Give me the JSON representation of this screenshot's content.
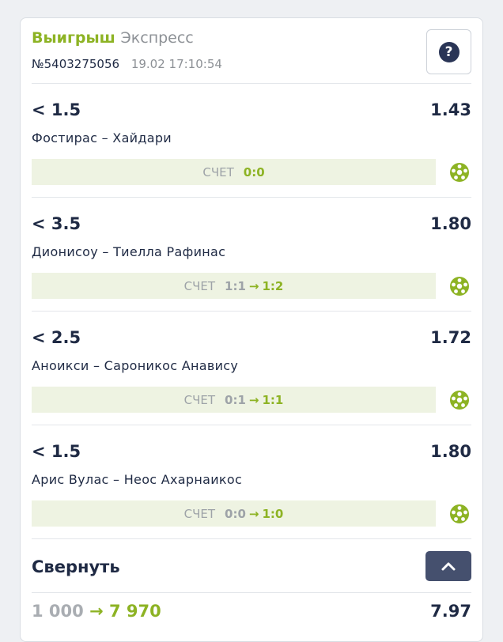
{
  "ticket": {
    "status": "Выигрыш",
    "type": "Экспресс",
    "number": "№5403275056",
    "datetime": "19.02 17:10:54",
    "help_icon": "question-icon",
    "help_label": "?"
  },
  "bets": [
    {
      "market": "< 1.5",
      "odds": "1.43",
      "match": "Фостирас – Хайдари",
      "score_label": "СЧЕТ",
      "score_start": "",
      "score_final": "0:0"
    },
    {
      "market": "< 3.5",
      "odds": "1.80",
      "match": "Дионисоу – Тиелла Рафинас",
      "score_label": "СЧЕТ",
      "score_start": "1:1",
      "score_final": "1:2"
    },
    {
      "market": "< 2.5",
      "odds": "1.72",
      "match": "Аноикси – Сароникос Анавису",
      "score_label": "СЧЕТ",
      "score_start": "0:1",
      "score_final": "1:1"
    },
    {
      "market": "< 1.5",
      "odds": "1.80",
      "match": "Арис Вулас – Неос Ахарнаикос",
      "score_label": "СЧЕТ",
      "score_start": "0:0",
      "score_final": "1:0"
    }
  ],
  "collapse": {
    "label": "Свернуть",
    "icon": "chevron-up-icon"
  },
  "footer": {
    "stake": "1 000",
    "arrow": "→",
    "payout": "7 970",
    "total_odds": "7.97"
  },
  "colors": {
    "accent": "#8db324",
    "dark": "#1f2a44",
    "button": "#45506e"
  }
}
